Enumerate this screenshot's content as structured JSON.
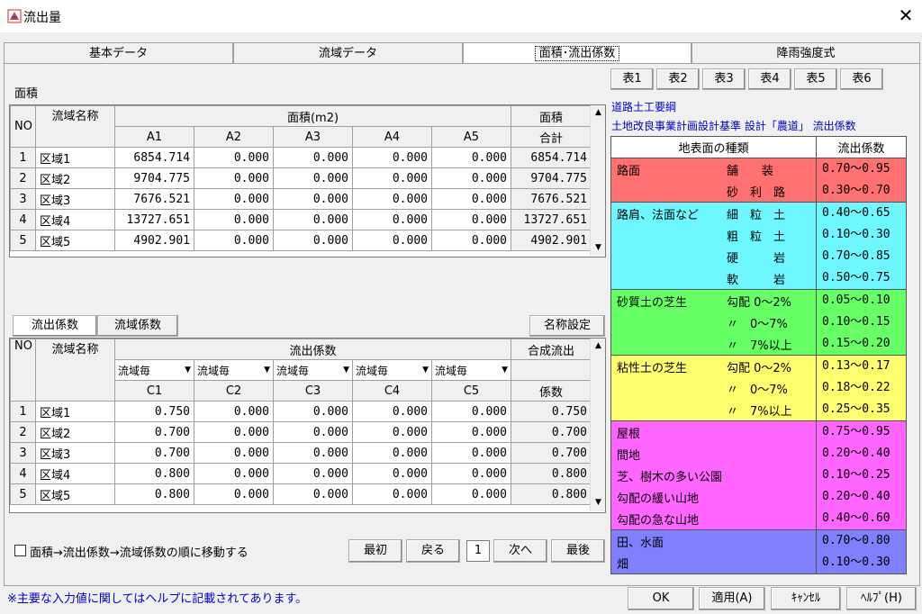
{
  "window": {
    "title": "流出量",
    "close_glyph": "✕"
  },
  "tabs": [
    {
      "label": "基本データ",
      "active": false
    },
    {
      "label": "流域データ",
      "active": false
    },
    {
      "label": "面積･流出係数",
      "active": true
    },
    {
      "label": "降雨強度式",
      "active": false
    }
  ],
  "area": {
    "section_label": "面積",
    "header": {
      "no": "NO",
      "name": "流域名称",
      "area_group": "面積(m2)",
      "total_top": "面積",
      "total_bottom": "合計"
    },
    "cols": [
      "A1",
      "A2",
      "A3",
      "A4",
      "A5"
    ],
    "rows": [
      {
        "no": "1",
        "name": "区域1",
        "values": [
          "6854.714",
          "0.000",
          "0.000",
          "0.000",
          "0.000"
        ],
        "total": "6854.714"
      },
      {
        "no": "2",
        "name": "区域2",
        "values": [
          "9704.775",
          "0.000",
          "0.000",
          "0.000",
          "0.000"
        ],
        "total": "9704.775"
      },
      {
        "no": "3",
        "name": "区域3",
        "values": [
          "7676.521",
          "0.000",
          "0.000",
          "0.000",
          "0.000"
        ],
        "total": "7676.521"
      },
      {
        "no": "4",
        "name": "区域4",
        "values": [
          "13727.651",
          "0.000",
          "0.000",
          "0.000",
          "0.000"
        ],
        "total": "13727.651"
      },
      {
        "no": "5",
        "name": "区域5",
        "values": [
          "4902.901",
          "0.000",
          "0.000",
          "0.000",
          "0.000"
        ],
        "total": "4902.901"
      }
    ]
  },
  "coef_tabs": {
    "tab1": "流出係数",
    "tab2": "流域係数",
    "rename_button": "名称設定"
  },
  "coef": {
    "header": {
      "no": "NO",
      "name": "流域名称",
      "group": "流出係数",
      "total_top": "合成流出",
      "total_bottom": "係数"
    },
    "dropdown_value": "流域毎",
    "cols": [
      "C1",
      "C2",
      "C3",
      "C4",
      "C5"
    ],
    "rows": [
      {
        "no": "1",
        "name": "区域1",
        "values": [
          "0.750",
          "0.000",
          "0.000",
          "0.000",
          "0.000"
        ],
        "total": "0.750"
      },
      {
        "no": "2",
        "name": "区域2",
        "values": [
          "0.700",
          "0.000",
          "0.000",
          "0.000",
          "0.000"
        ],
        "total": "0.700"
      },
      {
        "no": "3",
        "name": "区域3",
        "values": [
          "0.700",
          "0.000",
          "0.000",
          "0.000",
          "0.000"
        ],
        "total": "0.700"
      },
      {
        "no": "4",
        "name": "区域4",
        "values": [
          "0.800",
          "0.000",
          "0.000",
          "0.000",
          "0.000"
        ],
        "total": "0.800"
      },
      {
        "no": "5",
        "name": "区域5",
        "values": [
          "0.800",
          "0.000",
          "0.000",
          "0.000",
          "0.000"
        ],
        "total": "0.800"
      }
    ]
  },
  "move_checkbox_label": "面積→流出係数→流域係数の順に移動する",
  "nav": {
    "first": "最初",
    "prev": "戻る",
    "page": "1",
    "next": "次へ",
    "last": "最後"
  },
  "table_tabs": [
    "表1",
    "表2",
    "表3",
    "表4",
    "表5",
    "表6"
  ],
  "reference": {
    "line1": "道路土工要綱",
    "line2": "土地改良事業計画設計基準 設計「農道」 流出係数",
    "header_type": "地表面の種類",
    "header_coef": "流出係数",
    "groups": [
      {
        "color": "#ff7070",
        "items": [
          {
            "name": "路面",
            "sub": "舗　　装",
            "val": "0.70～0.95"
          },
          {
            "name": "",
            "sub": "砂　利　路",
            "val": "0.30～0.70"
          }
        ]
      },
      {
        "color": "#6ff7ff",
        "items": [
          {
            "name": "路肩、法面など",
            "sub": "細　粒　土",
            "val": "0.40～0.65"
          },
          {
            "name": "",
            "sub": "粗　粒　土",
            "val": "0.10～0.30"
          },
          {
            "name": "",
            "sub": "硬　　　岩",
            "val": "0.70～0.85"
          },
          {
            "name": "",
            "sub": "軟　　　岩",
            "val": "0.50～0.75"
          }
        ]
      },
      {
        "color": "#66ff66",
        "items": [
          {
            "name": "砂質土の芝生",
            "sub": "勾配 0～2%",
            "val": "0.05～0.10"
          },
          {
            "name": "",
            "sub": "〃　0～7%",
            "val": "0.10～0.15"
          },
          {
            "name": "",
            "sub": "〃　7%以上",
            "val": "0.15～0.20"
          }
        ]
      },
      {
        "color": "#ffff6e",
        "items": [
          {
            "name": "粘性土の芝生",
            "sub": "勾配 0～2%",
            "val": "0.13～0.17"
          },
          {
            "name": "",
            "sub": "〃　0～7%",
            "val": "0.18～0.22"
          },
          {
            "name": "",
            "sub": "〃　7%以上",
            "val": "0.25～0.35"
          }
        ]
      },
      {
        "color": "#ff66ff",
        "items": [
          {
            "name": "屋根",
            "sub": "",
            "val": "0.75～0.95"
          },
          {
            "name": "間地",
            "sub": "",
            "val": "0.20～0.40"
          },
          {
            "name": "芝、樹木の多い公園",
            "sub": "",
            "val": "0.10～0.25"
          },
          {
            "name": "勾配の緩い山地",
            "sub": "",
            "val": "0.20～0.40"
          },
          {
            "name": "勾配の急な山地",
            "sub": "",
            "val": "0.40～0.60"
          }
        ]
      },
      {
        "color": "#8080ff",
        "items": [
          {
            "name": "田、水面",
            "sub": "",
            "val": "0.70～0.80"
          },
          {
            "name": "畑",
            "sub": "",
            "val": "0.10～0.30"
          }
        ]
      }
    ]
  },
  "status_note": "※主要な入力値に関してはヘルプに記載されてあります。",
  "buttons": {
    "ok": "OK",
    "apply": "適用(A)",
    "cancel": "ｷｬﾝｾﾙ",
    "help": "ﾍﾙﾌﾟ(H)"
  }
}
